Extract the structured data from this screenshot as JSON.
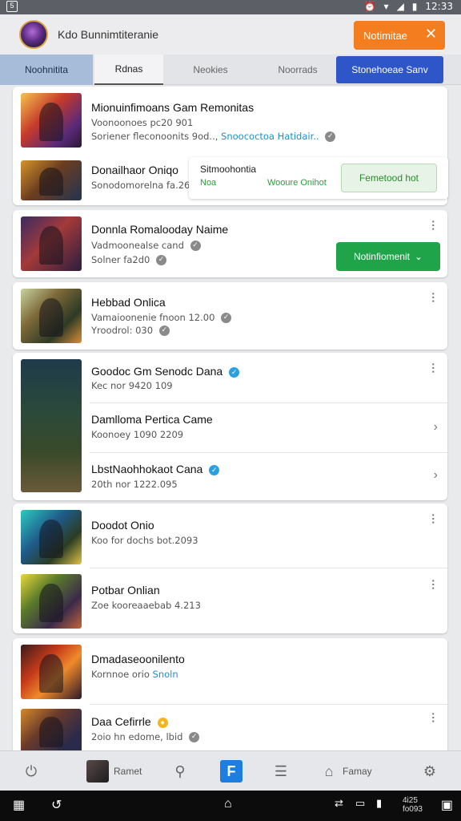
{
  "status_bar": {
    "left_badge": "5",
    "time": "12:33"
  },
  "header": {
    "app_title": "Kdo Bunnimtiteranie",
    "notify_label": "Notimitae",
    "close_glyph": "✕",
    "accent_color": "#f47d1f"
  },
  "tabs": [
    {
      "label": "Noohnitita"
    },
    {
      "label": "Rdnas"
    },
    {
      "label": "Neokies"
    },
    {
      "label": "Noorrads"
    }
  ],
  "tab_cta": "Stonehoeae Sanv",
  "cards": [
    {
      "rows": [
        {
          "title": "Mionuinfimoans Gam Remonitas",
          "sub1": "Voonoonoes pc20 901",
          "sub2_prefix": "Soriener fleconoonits 9od..,",
          "sub2_link": "Snoococtoa Hatidair..",
          "link_color": "#1f8fc4"
        },
        {
          "title": "Donailhaor Oniqo",
          "sub1": "Sonodomorelna fa.260"
        }
      ],
      "popup": {
        "title": "Sitmoohontia",
        "left": "Noa",
        "mid": "Wooure Onihot",
        "button": "Femetood hot"
      }
    },
    {
      "rows": [
        {
          "title": "Donnla Romalooday Naime",
          "sub1": "Vadmoonealse cand",
          "sub2": "Solner fa2d0"
        }
      ],
      "button": "Notinfiomenit"
    },
    {
      "rows": [
        {
          "title": "Hebbad Onlica",
          "sub1": "Vamaioonenie fnoon 12.00",
          "sub2": "Yroodrol: 030"
        }
      ]
    },
    {
      "rows": [
        {
          "title": "Goodoc Gm Senodc Dana",
          "sub1": "Kec nor 9420 109"
        },
        {
          "title": "Damlloma Pertica Came",
          "sub1": "Koonoey 1090 2209"
        },
        {
          "title": "LbstNaohhokaot Cana",
          "sub1": "20th nor 1222.095"
        }
      ]
    },
    {
      "rows": [
        {
          "title": "Doodot Onio",
          "sub1": "Koo for dochs bot.2093"
        },
        {
          "title": "Potbar Onlian",
          "sub1": "Zoe kooreaaebab 4.213"
        }
      ]
    },
    {
      "rows": [
        {
          "title": "Dmadaseoonilento",
          "sub1_prefix": "Kornnoe orio",
          "sub1_link": "Snoln"
        },
        {
          "title": "Daa Cefirrle",
          "sub1": "2oio hn edome, lbid"
        }
      ]
    }
  ],
  "bottom_nav": {
    "home_icon": "power-icon",
    "profile_label": "Ramet",
    "search_icon": "search-icon",
    "active_icon": "F",
    "list_icon": "list-icon",
    "games_label": "Famay",
    "settings_icon": "gear-icon"
  },
  "system_bar": {
    "info_line1": "4i25",
    "info_line2": "fo093"
  }
}
